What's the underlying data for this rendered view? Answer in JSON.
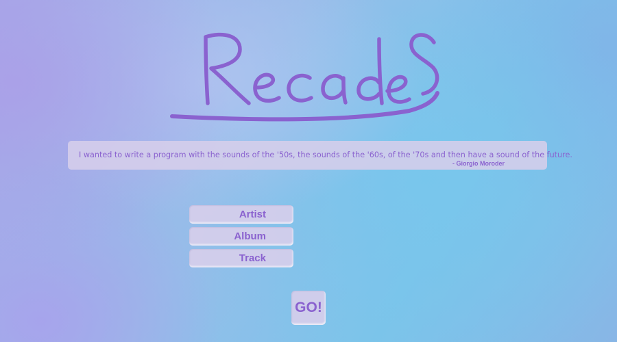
{
  "app": {
    "logo_text": "RecadeS",
    "brand_color": "#8a62cf"
  },
  "quote": {
    "text": "I wanted to write a program with the sounds of the '50s, the sounds of the '60s, of the '70s and then have a sound of the future.",
    "author": "- Giorgio Moroder"
  },
  "search_types": {
    "options": [
      {
        "label": "Artist"
      },
      {
        "label": "Album"
      },
      {
        "label": "Track"
      }
    ]
  },
  "go": {
    "label": "GO!"
  }
}
